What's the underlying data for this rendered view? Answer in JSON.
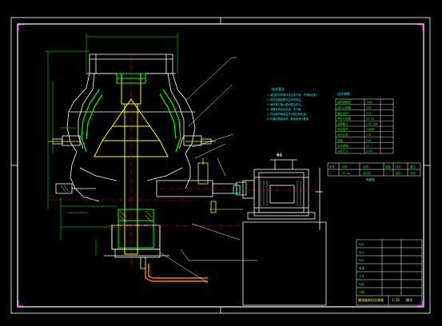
{
  "drawing": {
    "background": "#000000",
    "colors": {
      "frame": "#ffffff",
      "outline": "#ffffff",
      "yellow": "#ffff00",
      "green": "#00ff00",
      "magenta": "#ff00ff",
      "red": "#ff0000",
      "cyan": "#00ffff",
      "orange": "#ff8000"
    },
    "motor_label": "Φ6",
    "title_block_label": "图号"
  },
  "notes_panel": {
    "heading": "技术要求",
    "lines": [
      "1. 装配前所有零件应清洗干净，不得有毛刺。",
      "2. 各配合面装配时应涂润滑油。",
      "3. 破碎锥与偏心套间隙应均匀。",
      "4. 调整环转动应灵活，无卡阻。",
      "5. 试运转时轴承温升不超过规定值。",
      "6. 机器外表面涂漆，颜色按用户要求。"
    ]
  },
  "param_table": {
    "heading": "技术参数",
    "rows": [
      {
        "label": "破碎锥直径",
        "value": "1200"
      },
      {
        "label": "给料口宽度",
        "value": "150"
      },
      {
        "label": "最大给料",
        "value": "125"
      },
      {
        "label": "排料口调整",
        "value": "20-50"
      },
      {
        "label": "处理能力",
        "value": "110-168"
      },
      {
        "label": "电机型号",
        "value": "Y280M"
      },
      {
        "label": "电机功率",
        "value": "110"
      },
      {
        "label": "转速",
        "value": "740"
      },
      {
        "label": "主机重量",
        "value": "24.7"
      },
      {
        "label": "外形尺寸",
        "value": "2795"
      }
    ]
  },
  "parts_table": {
    "row1": [
      "序号",
      "代号",
      "名称",
      "数量",
      "材料",
      "备注"
    ],
    "row2": [
      "1",
      "GP-01",
      "电动机",
      "1",
      "组件",
      "外购"
    ],
    "caption": "明细表"
  },
  "title_block": {
    "rows": [
      "标记",
      "设计",
      "校对",
      "审核",
      "工艺",
      "批准",
      "日期"
    ],
    "name": "圆锥破碎机总装图",
    "scale": "1:20"
  }
}
